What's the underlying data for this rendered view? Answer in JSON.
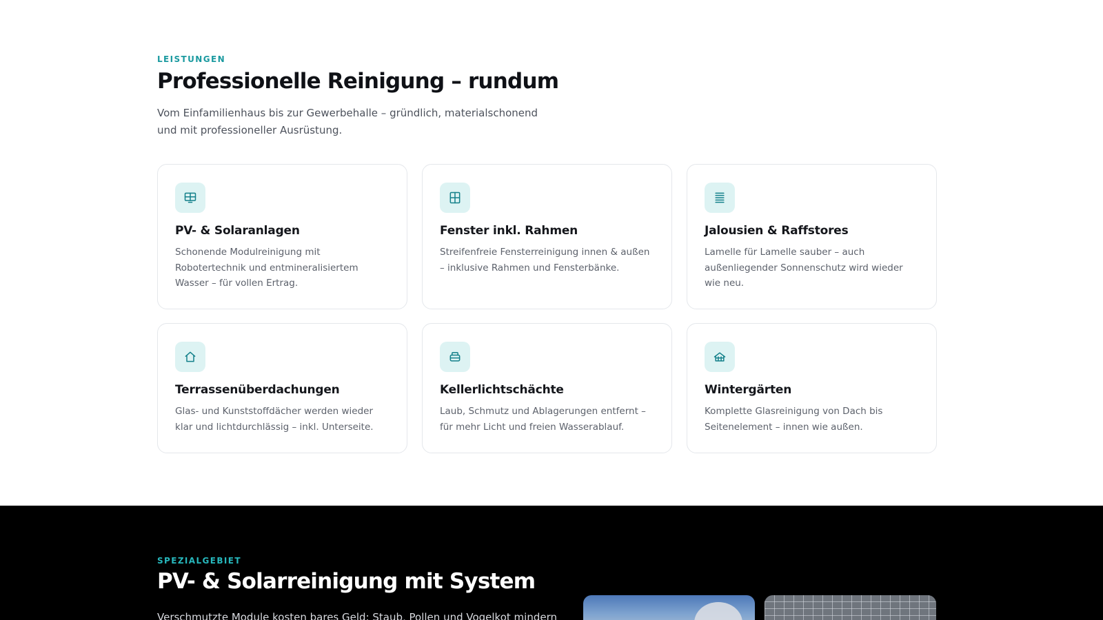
{
  "services": {
    "eyebrow": "LEISTUNGEN",
    "title": "Professionelle Reinigung – rundum",
    "lead": "Vom Einfamilienhaus bis zur Gewerbehalle – gründlich, materialschonend und mit professioneller Ausrüstung.",
    "cards": [
      {
        "icon": "solar-panel-icon",
        "title": "PV- & Solaranlagen",
        "text": "Schonende Modulreinigung mit Robotertechnik und entmineralisiertem Wasser – für vollen Ertrag."
      },
      {
        "icon": "window-icon",
        "title": "Fenster inkl. Rahmen",
        "text": "Streifenfreie Fensterreinigung innen & außen – inklusive Rahmen und Fensterbänke."
      },
      {
        "icon": "blinds-icon",
        "title": "Jalousien & Raffstores",
        "text": "Lamelle für Lamelle sauber – auch außenliegender Sonnenschutz wird wieder wie neu."
      },
      {
        "icon": "house-icon",
        "title": "Terrassenüberdachungen",
        "text": "Glas- und Kunststoffdächer werden wieder klar und lichtdurchlässig – inkl. Unterseite."
      },
      {
        "icon": "basement-icon",
        "title": "Kellerlichtschächte",
        "text": "Laub, Schmutz und Ablagerungen entfernt – für mehr Licht und freien Wasserablauf."
      },
      {
        "icon": "greenhouse-icon",
        "title": "Wintergärten",
        "text": "Komplette Glasreinigung von Dach bis Seitenelement – innen wie außen."
      }
    ]
  },
  "special": {
    "eyebrow": "SPEZIALGEBIET",
    "title": "PV- & Solarreinigung mit System",
    "lead": "Verschmutzte Module kosten bares Geld: Staub, Pollen und Vogelkot mindern"
  },
  "colors": {
    "accent": "#1b9aa0",
    "icon_bg": "#ddf3f3",
    "dark_bg": "#000000"
  }
}
